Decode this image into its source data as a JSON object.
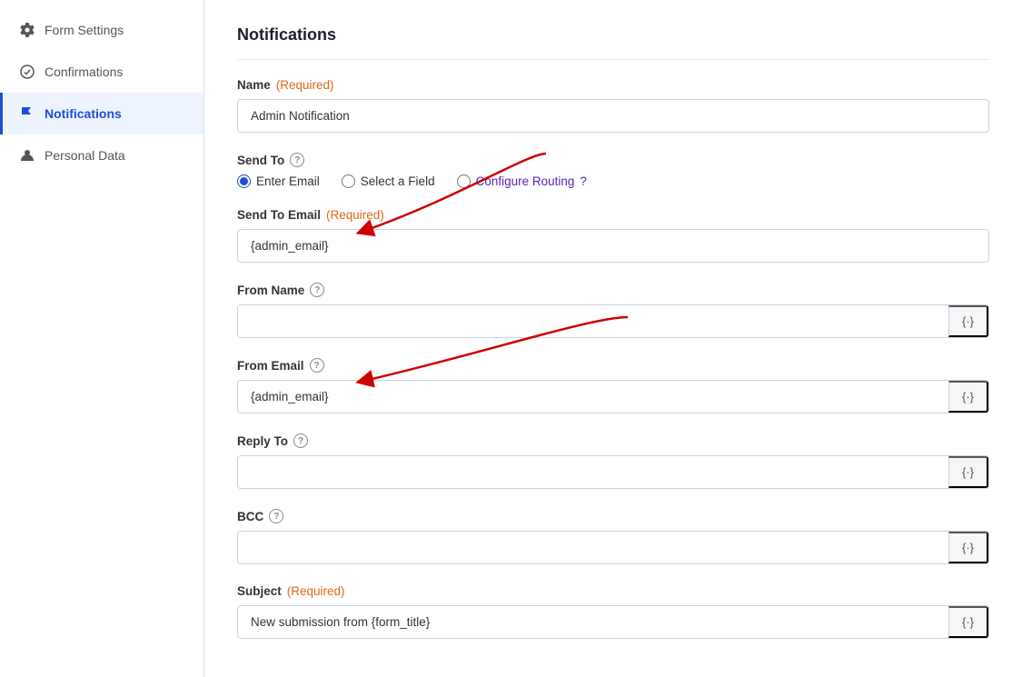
{
  "sidebar": {
    "items": [
      {
        "id": "form-settings",
        "label": "Form Settings",
        "icon": "gear",
        "active": false
      },
      {
        "id": "confirmations",
        "label": "Confirmations",
        "icon": "check-circle",
        "active": false
      },
      {
        "id": "notifications",
        "label": "Notifications",
        "icon": "flag",
        "active": true
      },
      {
        "id": "personal-data",
        "label": "Personal Data",
        "icon": "person",
        "active": false
      }
    ]
  },
  "main": {
    "title": "Notifications",
    "fields": {
      "name": {
        "label": "Name",
        "required_text": "(Required)",
        "value": "Admin Notification"
      },
      "send_to": {
        "label": "Send To",
        "help": true,
        "options": [
          {
            "id": "enter-email",
            "label": "Enter Email",
            "checked": true
          },
          {
            "id": "select-field",
            "label": "Select a Field",
            "checked": false
          },
          {
            "id": "configure-routing",
            "label": "Configure Routing",
            "checked": false
          }
        ]
      },
      "send_to_email": {
        "label": "Send To Email",
        "required_text": "(Required)",
        "value": "{admin_email}"
      },
      "from_name": {
        "label": "From Name",
        "help": true,
        "value": "",
        "merge_btn": "{·}"
      },
      "from_email": {
        "label": "From Email",
        "help": true,
        "value": "{admin_email}",
        "merge_btn": "{·}"
      },
      "reply_to": {
        "label": "Reply To",
        "help": true,
        "value": "",
        "merge_btn": "{·}"
      },
      "bcc": {
        "label": "BCC",
        "help": true,
        "value": "",
        "merge_btn": "{·}"
      },
      "subject": {
        "label": "Subject",
        "required_text": "(Required)",
        "value": "New submission from {form_title}",
        "merge_btn": "{·}"
      }
    }
  },
  "icons": {
    "gear": "⚙",
    "check_circle": "✓",
    "flag": "⚑",
    "person": "👤",
    "help": "?",
    "merge": "{·}"
  },
  "colors": {
    "active_sidebar": "#1d4ed8",
    "required": "#e06717",
    "routing_color": "#5b21b6"
  }
}
